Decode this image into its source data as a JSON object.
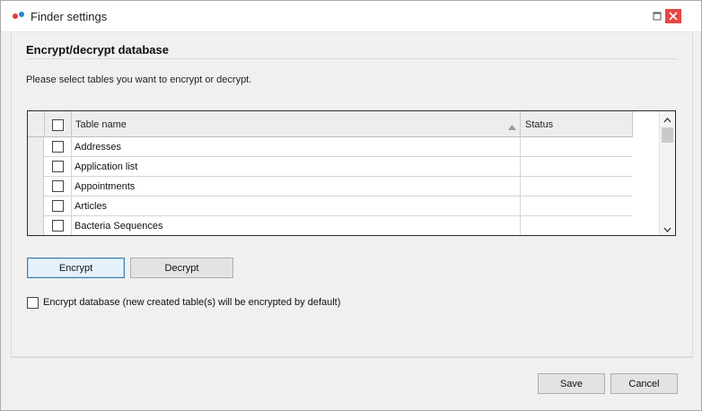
{
  "window": {
    "title": "Finder settings",
    "maximize_icon": "maximize-icon",
    "close_icon": "close-icon",
    "close_color": "#e64545"
  },
  "section": {
    "title": "Encrypt/decrypt database",
    "instructions": "Please select tables you want to encrypt or decrypt."
  },
  "grid": {
    "columns": [
      "Table name",
      "Status"
    ],
    "sort_icon": "sort-ascending-icon",
    "rows": [
      {
        "name": "Addresses",
        "status": ""
      },
      {
        "name": "Application list",
        "status": ""
      },
      {
        "name": "Appointments",
        "status": ""
      },
      {
        "name": "Articles",
        "status": ""
      },
      {
        "name": "Bacteria Sequences",
        "status": ""
      }
    ]
  },
  "actions": {
    "encrypt_label": "Encrypt",
    "decrypt_label": "Decrypt"
  },
  "options": {
    "encrypt_default_label": "Encrypt database (new created table(s) will be encrypted by default)",
    "encrypt_default_checked": false
  },
  "footer": {
    "save_label": "Save",
    "cancel_label": "Cancel"
  }
}
